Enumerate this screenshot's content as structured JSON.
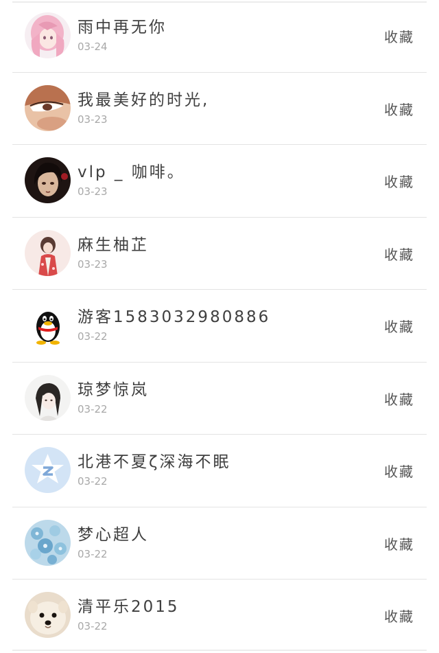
{
  "items": [
    {
      "name": "雨中再无你",
      "date": "03-24",
      "action": "收藏",
      "avatar": "anime-girl-pink-hair"
    },
    {
      "name": "我最美好的时光,",
      "date": "03-23",
      "action": "收藏",
      "avatar": "eye-closeup"
    },
    {
      "name": "vlp _ 咖啡。",
      "date": "03-23",
      "action": "收藏",
      "avatar": "dark-hair-doll"
    },
    {
      "name": "麻生柚芷",
      "date": "03-23",
      "action": "收藏",
      "avatar": "kimono-girl"
    },
    {
      "name": "游客1583032980886",
      "date": "03-22",
      "action": "收藏",
      "avatar": "qq-penguin"
    },
    {
      "name": "琼梦惊岚",
      "date": "03-22",
      "action": "收藏",
      "avatar": "girl-sketch"
    },
    {
      "name": "北港不夏ζ深海不眠",
      "date": "03-22",
      "action": "收藏",
      "avatar": "qzone-star"
    },
    {
      "name": "梦心超人",
      "date": "03-22",
      "action": "收藏",
      "avatar": "blue-flowers"
    },
    {
      "name": "清平乐2015",
      "date": "03-22",
      "action": "收藏",
      "avatar": "pomeranian-dog"
    }
  ]
}
